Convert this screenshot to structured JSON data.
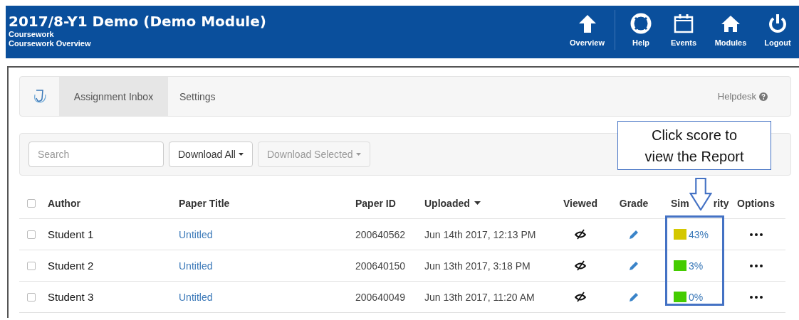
{
  "header": {
    "title": "2017/8-Y1 Demo (Demo Module)",
    "breadcrumbs": [
      "Coursework",
      "Coursework Overview"
    ],
    "nav": [
      {
        "label": "Overview",
        "kind": "arrow",
        "separator_after": true
      },
      {
        "label": "Help",
        "kind": "lifebuoy",
        "separator_after": false
      },
      {
        "label": "Events",
        "kind": "calendar",
        "separator_after": false
      },
      {
        "label": "Modules",
        "kind": "house",
        "separator_after": false
      },
      {
        "label": "Logout",
        "kind": "power",
        "separator_after": false
      }
    ]
  },
  "tabs": [
    {
      "label": "Assignment Inbox",
      "selected": true
    },
    {
      "label": "Settings",
      "selected": false
    }
  ],
  "helpdesk": "Helpdesk",
  "toolbar": {
    "search": {
      "placeholder": "Search"
    },
    "buttons": [
      {
        "label": "Download All",
        "disabled": false
      },
      {
        "label": "Download Selected",
        "disabled": true
      }
    ]
  },
  "table": {
    "select_all": {
      "checked": false
    },
    "columns": [
      {
        "label": "Author"
      },
      {
        "label": "Paper Title"
      },
      {
        "label": "Paper ID"
      },
      {
        "label": "Uploaded",
        "sorted": true
      },
      {
        "label": "Viewed"
      },
      {
        "label": "Grade"
      },
      {
        "label": "Sim",
        "label_end": "rity"
      },
      {
        "label": "Options"
      }
    ],
    "rows": [
      {
        "checked": false,
        "author": "Student 1",
        "paper_title": "Untitled",
        "paper_id": "200640562",
        "uploaded": "Jun 14th 2017, 12:13 PM",
        "similarity": "43%",
        "color": "#d4c800"
      },
      {
        "checked": false,
        "author": "Student 2",
        "paper_title": "Untitled",
        "paper_id": "200640150",
        "uploaded": "Jun 13th 2017, 3:18 PM",
        "similarity": "3%",
        "color": "#44cc00"
      },
      {
        "checked": false,
        "author": "Student 3",
        "paper_title": "Untitled",
        "paper_id": "200640049",
        "uploaded": "Jun 13th 2017, 11:20 AM",
        "similarity": "0%",
        "color": "#44cc00"
      }
    ]
  },
  "annotation": {
    "callout": "Click score to\nview the Report"
  }
}
